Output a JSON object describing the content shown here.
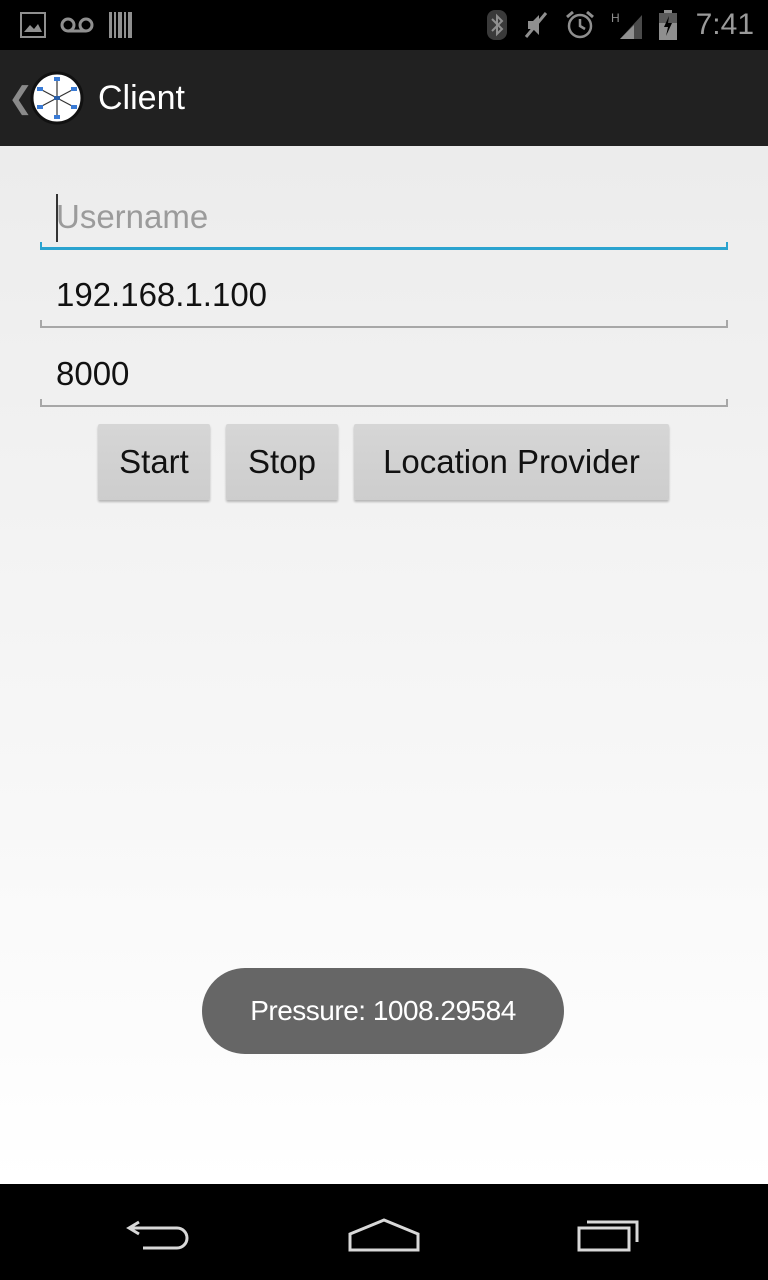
{
  "status_bar": {
    "left_icons": [
      "image-icon",
      "voicemail-icon",
      "barcode-icon"
    ],
    "right_icons": [
      "bluetooth-icon",
      "mute-icon",
      "alarm-icon",
      "signal-icon",
      "battery-icon"
    ],
    "network_type": "H",
    "time": "7:41"
  },
  "action_bar": {
    "title": "Client",
    "logo_icon": "network-hub-icon",
    "up_icon": "chevron-left-icon"
  },
  "form": {
    "username": {
      "placeholder": "Username",
      "value": ""
    },
    "server_ip": {
      "value": "192.168.1.100"
    },
    "port": {
      "value": "8000"
    }
  },
  "buttons": {
    "start": "Start",
    "stop": "Stop",
    "location_provider": "Location Provider"
  },
  "toast": {
    "message": "Pressure: 1008.29584"
  },
  "nav_bar": {
    "back_icon": "back-icon",
    "home_icon": "home-icon",
    "recents_icon": "recents-icon"
  },
  "colors": {
    "accent": "#2aa3cf",
    "action_bar": "#212121",
    "toast_bg": "#666666"
  }
}
